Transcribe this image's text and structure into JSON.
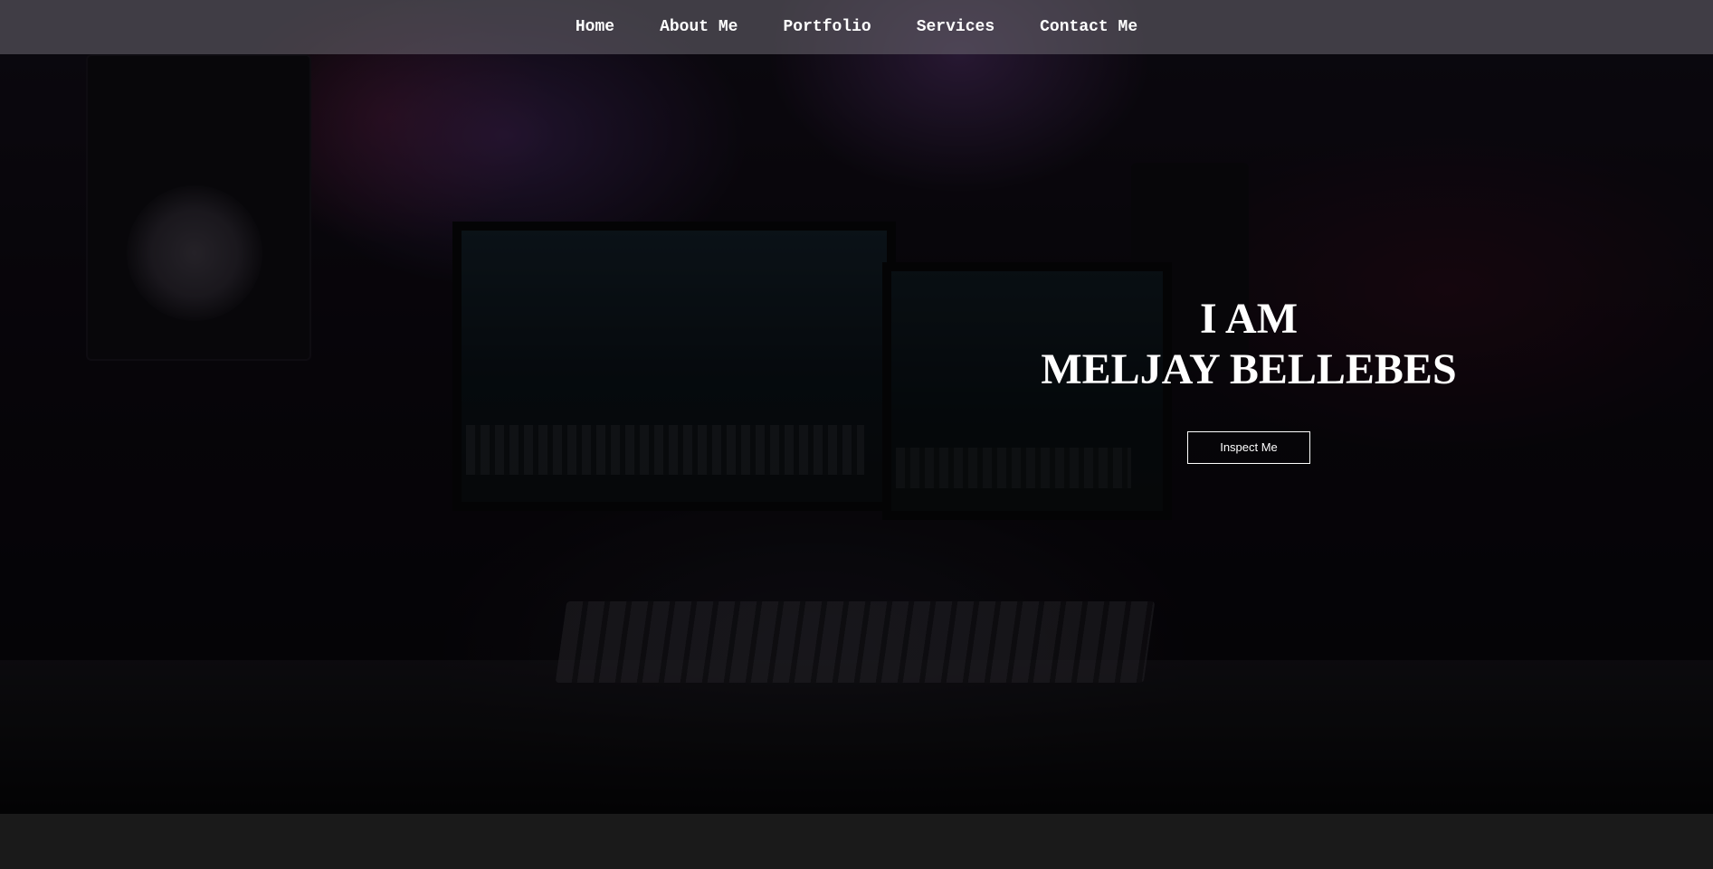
{
  "nav": {
    "items": [
      {
        "label": "Home"
      },
      {
        "label": "About Me"
      },
      {
        "label": "Portfolio"
      },
      {
        "label": "Services"
      },
      {
        "label": "Contact Me"
      }
    ]
  },
  "hero": {
    "title_line1": "I AM",
    "title_line2": "MELJAY BELLEBES",
    "button_label": "Inspect Me"
  },
  "colors": {
    "text": "#ffffff",
    "nav_background": "#6e6973",
    "page_background": "#1a1a1a"
  }
}
